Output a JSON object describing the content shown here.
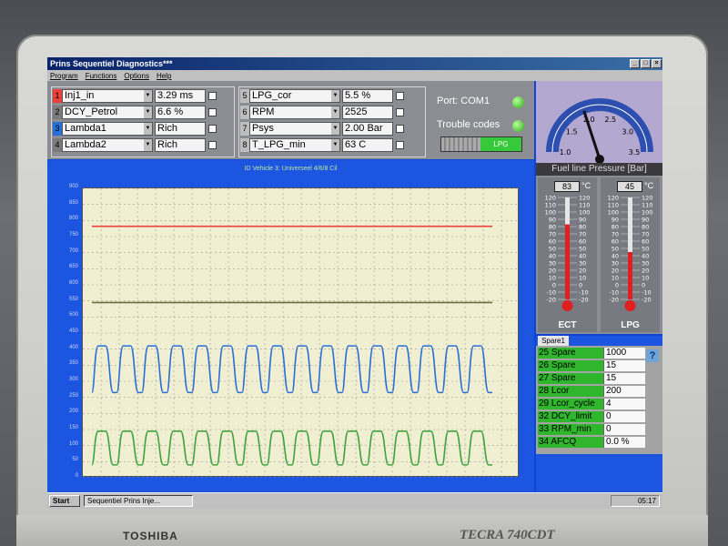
{
  "window": {
    "title": "Prins Sequentiel Diagnostics***",
    "menu": [
      "Program",
      "Functions",
      "Options",
      "Help"
    ]
  },
  "params_left": [
    {
      "idx": "1",
      "name": "Inj1_in",
      "value": "3.29 ms"
    },
    {
      "idx": "2",
      "name": "DCY_Petrol",
      "value": "6.6 %"
    },
    {
      "idx": "3",
      "name": "Lambda1",
      "value": "Rich"
    },
    {
      "idx": "4",
      "name": "Lambda2",
      "value": "Rich"
    }
  ],
  "params_right": [
    {
      "idx": "5",
      "name": "LPG_cor",
      "value": "5.5 %"
    },
    {
      "idx": "6",
      "name": "RPM",
      "value": "2525"
    },
    {
      "idx": "7",
      "name": "Psys",
      "value": "2.00 Bar"
    },
    {
      "idx": "8",
      "name": "T_LPG_min",
      "value": "63 C"
    }
  ],
  "indicators": {
    "port_label": "Port: COM1",
    "trouble_label": "Trouble codes",
    "fuel_toggle_label": "LPG"
  },
  "gauge": {
    "label": "Fuel line Pressure [Bar]",
    "ticks": [
      "1.0",
      "1.5",
      "2.0",
      "2.5",
      "3.0",
      "3.5"
    ],
    "value": 2.0
  },
  "chart": {
    "title": "ID Vehicle 3: Universeel 4/6/8 Cil"
  },
  "chart_data": {
    "type": "line",
    "title": "ID Vehicle 3: Universeel 4/6/8 Cil",
    "ylim": [
      0,
      900
    ],
    "yticks": [
      900,
      850,
      800,
      750,
      700,
      650,
      600,
      550,
      500,
      450,
      400,
      350,
      300,
      250,
      200,
      150,
      100,
      50,
      0
    ],
    "series": [
      {
        "color": "#e8413c",
        "values": [
          782,
          782
        ]
      },
      {
        "color": "#6b6b3a",
        "values": [
          545,
          545
        ]
      },
      {
        "color": "#2a6fd6",
        "low": 265,
        "high": 410,
        "cycles": 16
      },
      {
        "color": "#3fa33f",
        "low": 40,
        "high": 145,
        "cycles": 16
      }
    ]
  },
  "thermometers": [
    {
      "readout": "83",
      "unit": "°C",
      "label": "ECT",
      "value": 83
    },
    {
      "readout": "45",
      "unit": "°C",
      "label": "LPG",
      "value": 45
    }
  ],
  "therm_scale": [
    "120",
    "110",
    "100",
    "90",
    "80",
    "70",
    "60",
    "50",
    "40",
    "30",
    "20",
    "10",
    "0",
    "-10",
    "-20"
  ],
  "spare": {
    "tab": "Spare1",
    "help": "?",
    "rows": [
      {
        "name": "25 Spare",
        "value": "1000"
      },
      {
        "name": "26 Spare",
        "value": "15"
      },
      {
        "name": "27 Spare",
        "value": "15"
      },
      {
        "name": "28 Lcor",
        "value": "200"
      },
      {
        "name": "29 Lcor_cycle",
        "value": "4"
      },
      {
        "name": "32 DCY_limit",
        "value": "0"
      },
      {
        "name": "33 RPM_min",
        "value": "0"
      },
      {
        "name": "34 AFCQ",
        "value": "0.0 %"
      }
    ]
  },
  "taskbar": {
    "start": "Start",
    "item": "Sequentiel Prins Inje...",
    "clock": "05:17"
  },
  "laptop": {
    "brand": "TOSHIBA",
    "model": "TECRA 740CDT"
  }
}
